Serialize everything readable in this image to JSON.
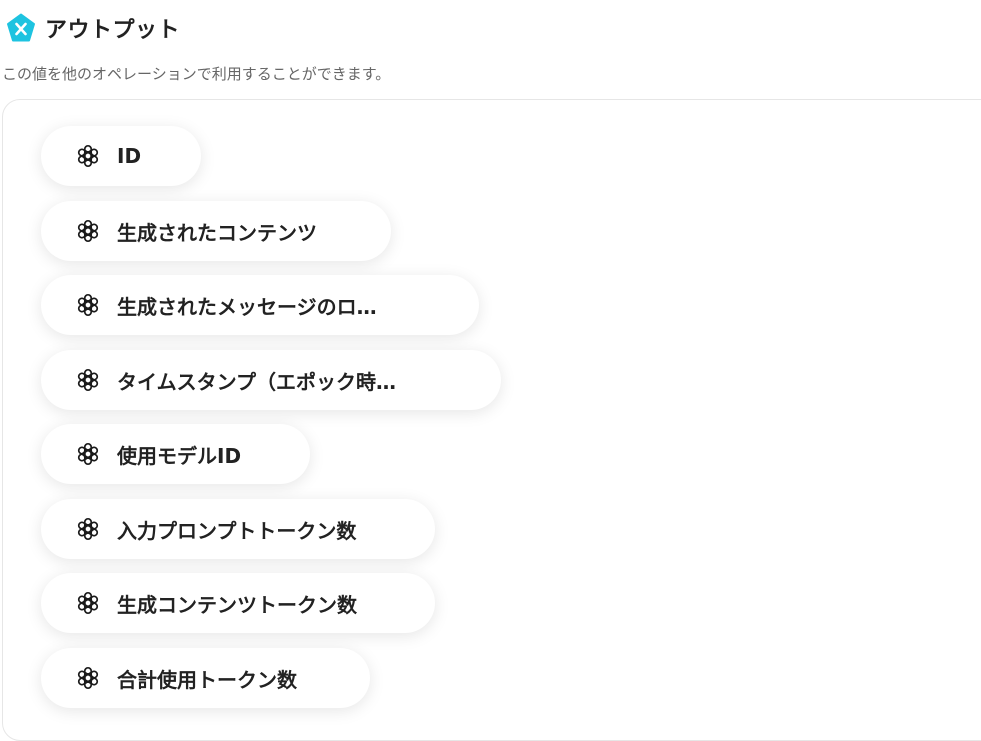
{
  "header": {
    "title": "アウトプット",
    "subtitle": "この値を他のオペレーションで利用することができます。",
    "logo_color": "#1ec3e0"
  },
  "outputs": [
    {
      "label": "ID",
      "icon": "openai-icon"
    },
    {
      "label": "生成されたコンテンツ",
      "icon": "openai-icon"
    },
    {
      "label": "生成されたメッセージのロ…",
      "icon": "openai-icon"
    },
    {
      "label": "タイムスタンプ（エポック時…",
      "icon": "openai-icon"
    },
    {
      "label": "使用モデルID",
      "icon": "openai-icon"
    },
    {
      "label": "入力プロンプトトークン数",
      "icon": "openai-icon"
    },
    {
      "label": "生成コンテンツトークン数",
      "icon": "openai-icon"
    },
    {
      "label": "合計使用トークン数",
      "icon": "openai-icon"
    }
  ]
}
